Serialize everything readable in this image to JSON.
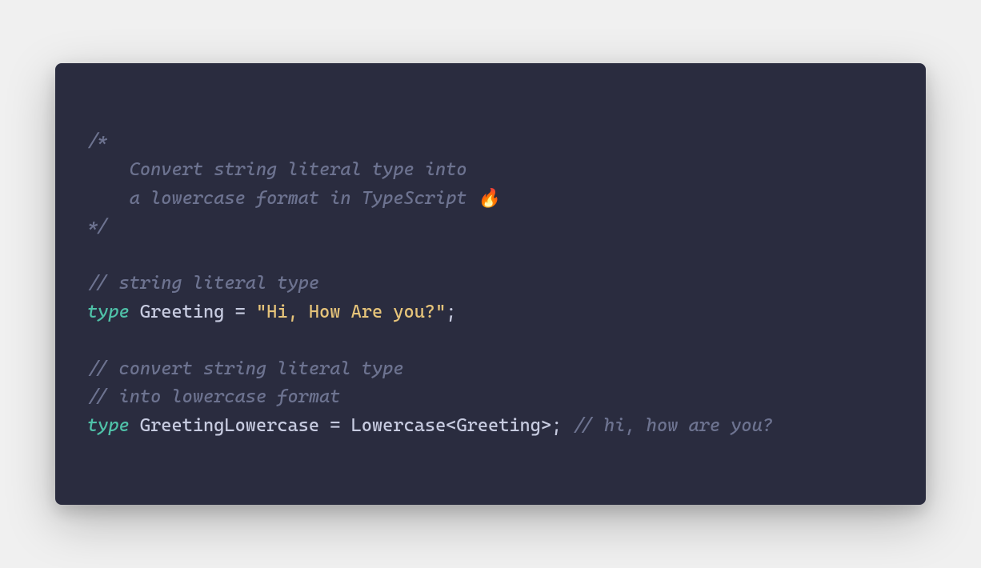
{
  "code": {
    "block_comment_open": "/*",
    "block_comment_line1": "    Convert string literal type into",
    "block_comment_line2": "    a lowercase format in TypeScript 🔥",
    "block_comment_close": "*/",
    "comment1": "// string literal type",
    "keyword_type1": "type",
    "typename1": "Greeting",
    "equals1": "=",
    "string_literal": "\"Hi, How Are you?\"",
    "semi1": ";",
    "comment2": "// convert string literal type",
    "comment3": "// into lowercase format",
    "keyword_type2": "type",
    "typename2": "GreetingLowercase",
    "equals2": "=",
    "utility_name": "Lowercase",
    "angle_open": "<",
    "generic_arg": "Greeting",
    "angle_close": ">",
    "semi2": ";",
    "trailing_comment": "// hi, how are you?"
  }
}
